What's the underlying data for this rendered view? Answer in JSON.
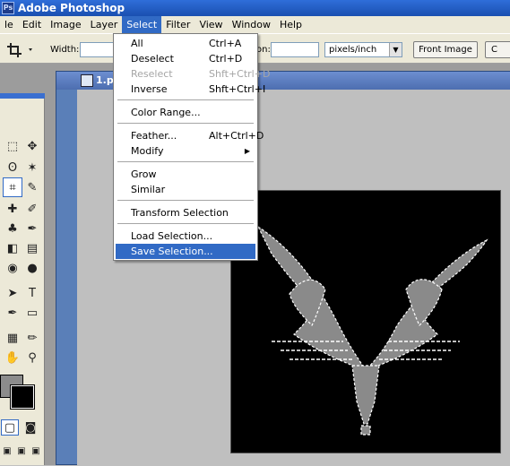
{
  "app": {
    "title": "Adobe Photoshop"
  },
  "menubar": {
    "items": [
      {
        "label": "le"
      },
      {
        "label": "Edit"
      },
      {
        "label": "Image"
      },
      {
        "label": "Layer"
      },
      {
        "label": "Select"
      },
      {
        "label": "Filter"
      },
      {
        "label": "View"
      },
      {
        "label": "Window"
      },
      {
        "label": "Help"
      }
    ],
    "active": "Select"
  },
  "options": {
    "width_label": "Width:",
    "width_value": "",
    "height_label_fragment": "on:",
    "height_value": "",
    "units": "pixels/inch",
    "front_image": "Front Image",
    "clear_fragment": "C"
  },
  "select_menu": {
    "items": [
      {
        "label": "All",
        "shortcut": "Ctrl+A"
      },
      {
        "label": "Deselect",
        "shortcut": "Ctrl+D"
      },
      {
        "label": "Reselect",
        "shortcut": "Shft+Ctrl+D",
        "disabled": true
      },
      {
        "label": "Inverse",
        "shortcut": "Shft+Ctrl+I"
      },
      {
        "label": "Color Range..."
      },
      {
        "label": "Feather...",
        "shortcut": "Alt+Ctrl+D"
      },
      {
        "label": "Modify",
        "submenu": true
      },
      {
        "label": "Grow"
      },
      {
        "label": "Similar"
      },
      {
        "label": "Transform Selection"
      },
      {
        "label": "Load Selection..."
      },
      {
        "label": "Save Selection...",
        "highlighted": true
      }
    ]
  },
  "document": {
    "title": "1.ps"
  },
  "colors": {
    "accent": "#316ac5",
    "foreground_swatch": "#8c8c8c",
    "background_swatch": "#000000"
  }
}
